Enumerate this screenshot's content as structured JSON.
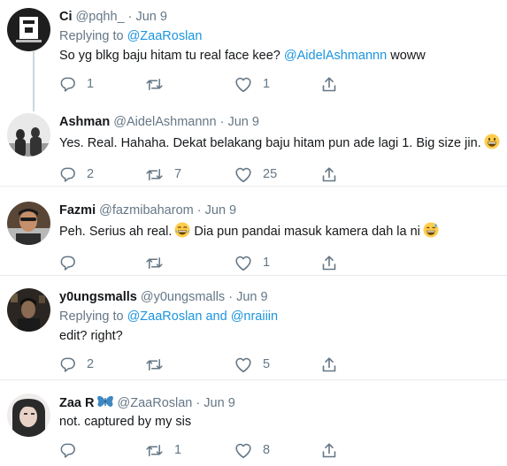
{
  "tweets": [
    {
      "name": "Ci",
      "handle": "@pqhh_",
      "dot": "·",
      "date": "Jun 9",
      "replying_prefix": "Replying to",
      "replying_to": "@ZaaRoslan",
      "text": "So yg blkg baju hitam tu real face kee?",
      "mention": "@AidelAshmannn",
      "text_suffix": "woww",
      "replies": "1",
      "retweets": "",
      "likes": "1"
    },
    {
      "name": "Ashman",
      "handle": "@AidelAshmannn",
      "dot": "·",
      "date": "Jun 9",
      "text": "Yes. Real. Hahaha. Dekat belakang baju hitam pun ade lagi 1. Big size jin.",
      "emoji": "grinning-face",
      "replies": "2",
      "retweets": "7",
      "likes": "25"
    },
    {
      "name": "Fazmi",
      "handle": "@fazmibaharom",
      "dot": "·",
      "date": "Jun 9",
      "text_a": "Peh. Serius ah real.",
      "emoji_a": "tears-of-joy",
      "text_b": "Dia pun pandai masuk kamera dah la ni",
      "emoji_b": "grinning-sweat",
      "replies": "",
      "retweets": "",
      "likes": "1"
    },
    {
      "name": "y0ungsmalls",
      "handle": "@y0ungsmalls",
      "dot": "·",
      "date": "Jun 9",
      "replying_prefix": "Replying to",
      "replying_to": "@ZaaRoslan",
      "replying_and": "and",
      "replying_to_2": "@nraiiin",
      "text": "edit? right?",
      "replies": "2",
      "retweets": "",
      "likes": "5"
    },
    {
      "name": "Zaa R",
      "name_badge": "blue-butterfly",
      "handle": "@ZaaRoslan",
      "dot": "·",
      "date": "Jun 9",
      "text": "not. captured by my sis",
      "replies": "",
      "retweets": "1",
      "likes": "8"
    }
  ],
  "colors": {
    "text": "#14171a",
    "secondary": "#657786",
    "link": "#1b95e0",
    "thread_line": "#ccd6dd",
    "divider": "#e6ecf0"
  }
}
